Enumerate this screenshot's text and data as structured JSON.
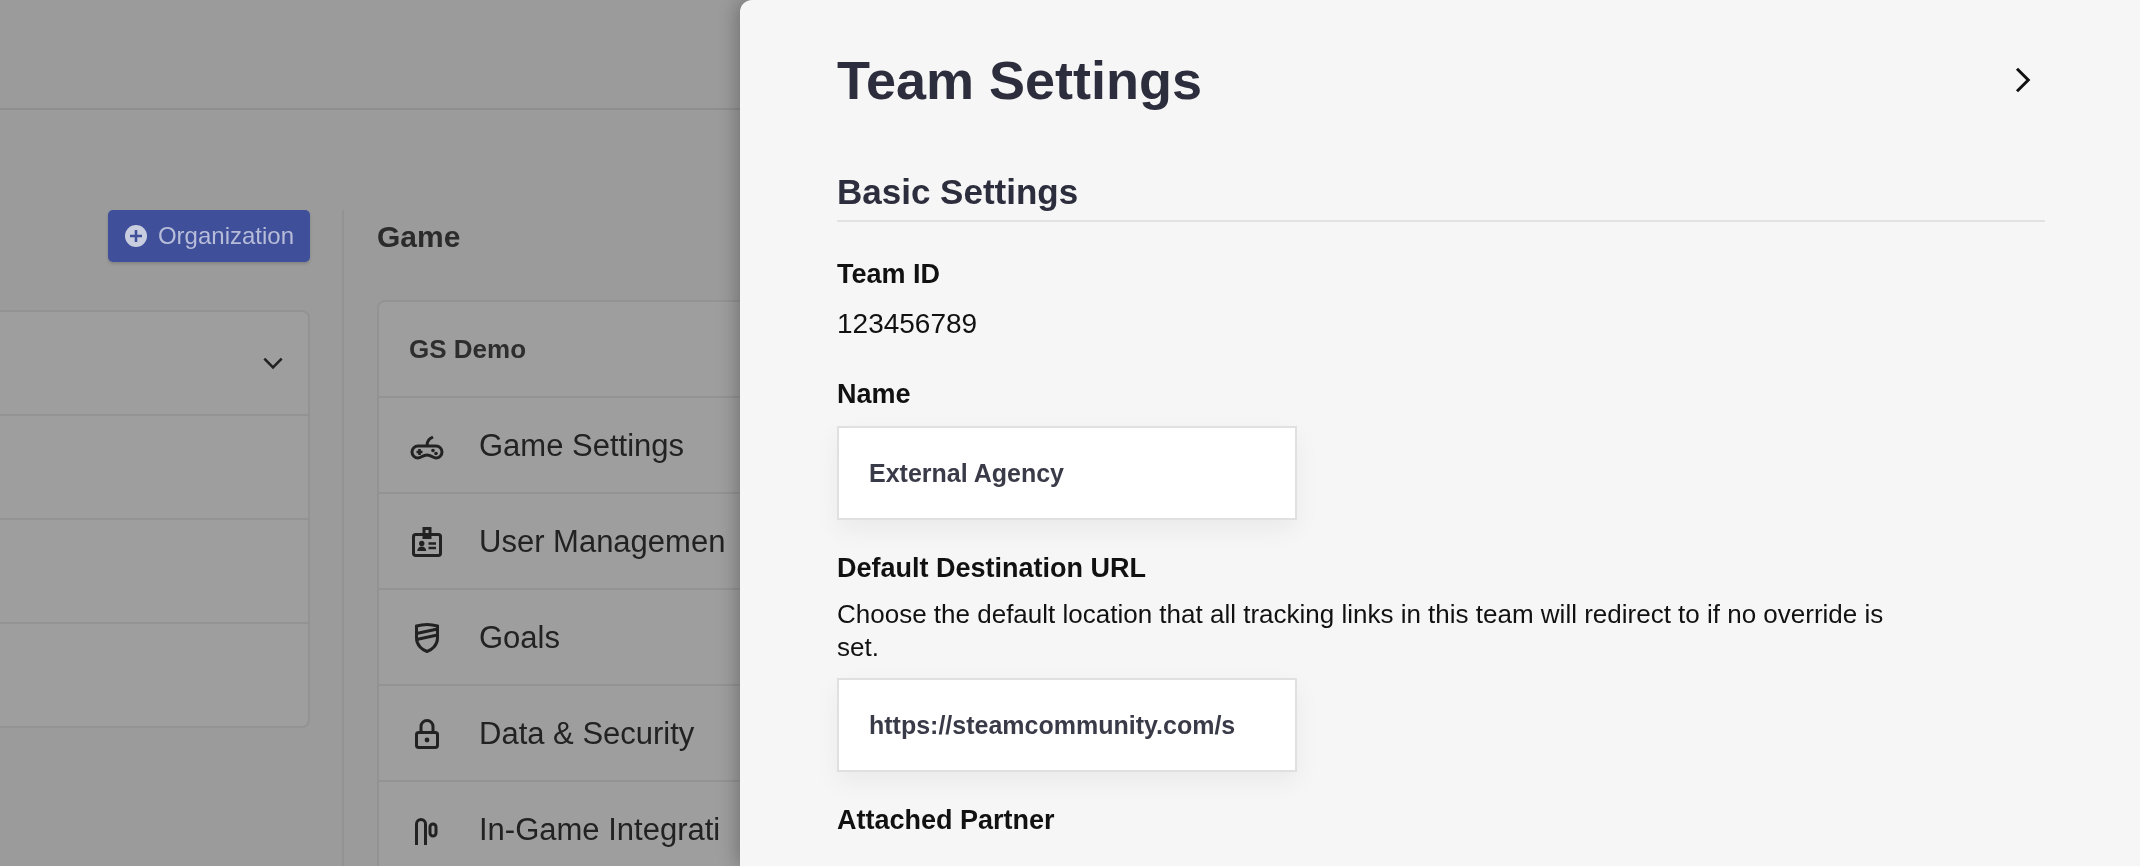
{
  "background": {
    "organization_button": "Organization",
    "game_heading": "Game",
    "game_card": {
      "title": "GS Demo",
      "items": [
        {
          "label": "Game Settings"
        },
        {
          "label": "User Managemen"
        },
        {
          "label": "Goals"
        },
        {
          "label": "Data & Security"
        },
        {
          "label": "In-Game Integrati"
        }
      ]
    }
  },
  "panel": {
    "title": "Team Settings",
    "section": "Basic Settings",
    "fields": [
      {
        "kind": "static",
        "label": "Team ID",
        "value": "123456789"
      },
      {
        "kind": "input",
        "label": "Name",
        "value": "External Agency"
      },
      {
        "kind": "input",
        "label": "Default Destination URL",
        "description": "Choose the default location that all tracking links in this team will redirect to if no override is set.",
        "value": "https://steamcommunity.com/s"
      },
      {
        "kind": "heading",
        "label": "Attached Partner"
      }
    ]
  }
}
